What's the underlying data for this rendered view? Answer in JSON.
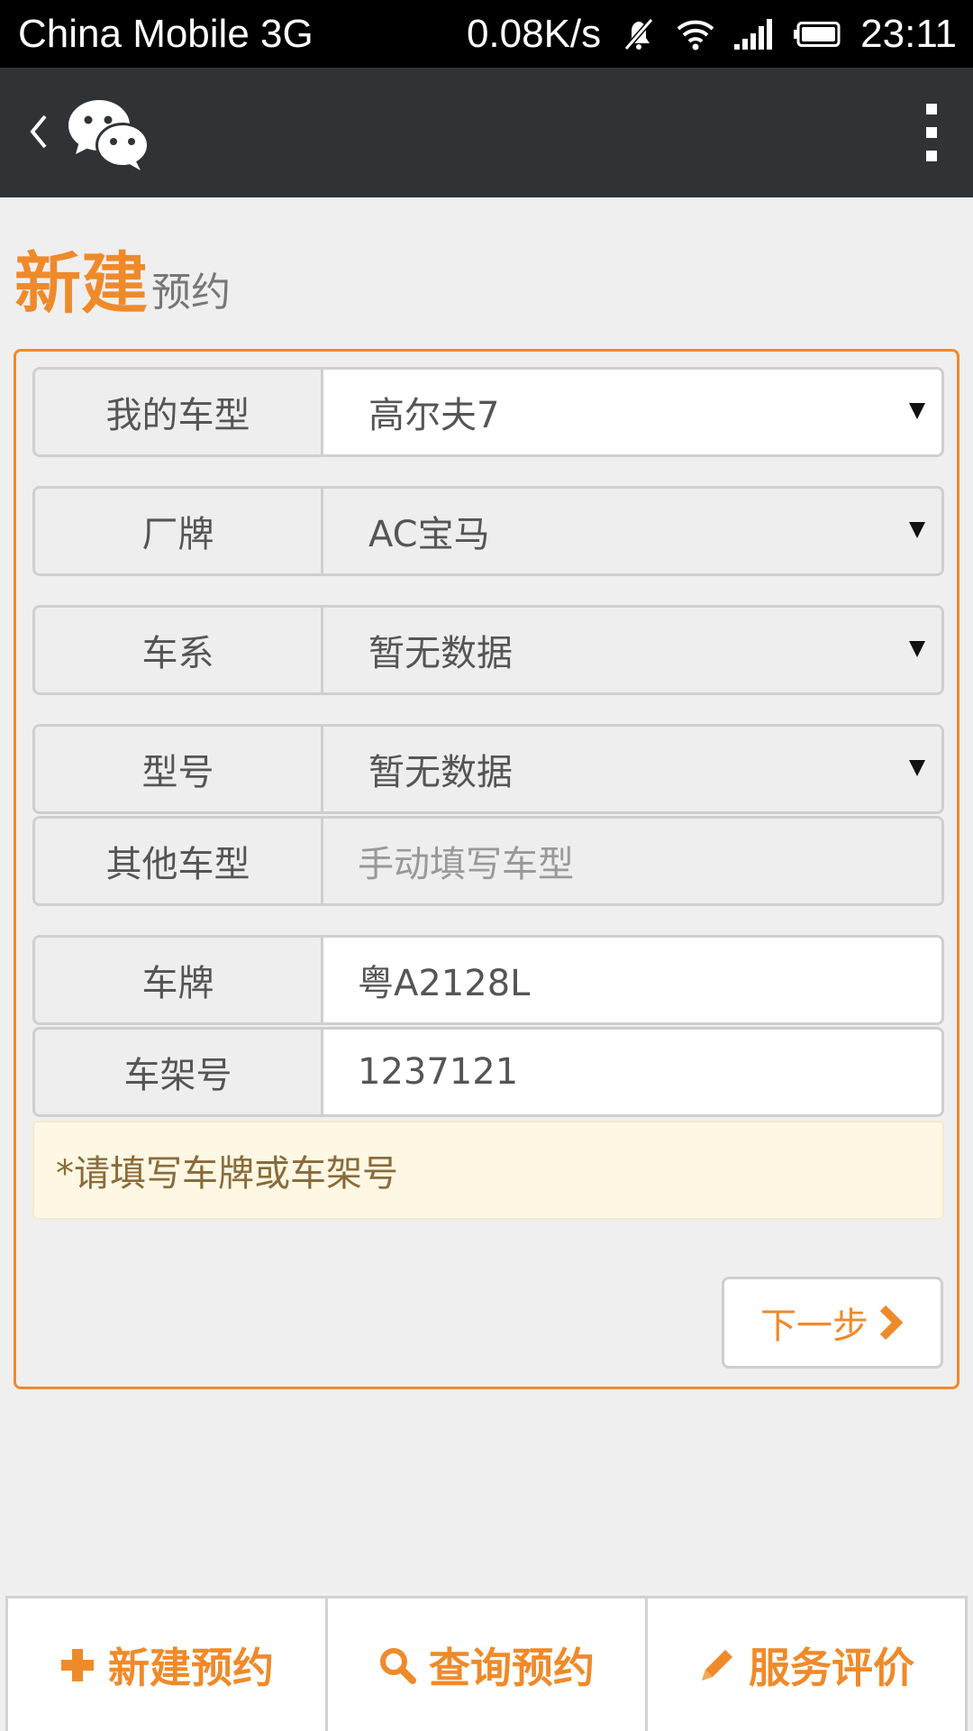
{
  "status_bar": {
    "carrier": "China Mobile 3G",
    "speed": "0.08K/s",
    "time": "23:11",
    "icons": [
      "mute-icon",
      "wifi-icon",
      "signal-icon",
      "battery-icon"
    ]
  },
  "action_bar": {
    "back_icon": "back-chevron-icon",
    "app_icon": "wechat-icon",
    "menu_icon": "more-vertical-icon"
  },
  "page_title": {
    "bold": "新建",
    "light": "预约"
  },
  "form": {
    "car_model": {
      "label": "我的车型",
      "value": "高尔夫7"
    },
    "brand": {
      "label": "厂牌",
      "value": "AC宝马"
    },
    "series": {
      "label": "车系",
      "value": "暂无数据"
    },
    "model_no": {
      "label": "型号",
      "value": "暂无数据"
    },
    "other_model": {
      "label": "其他车型",
      "placeholder": "手动填写车型"
    },
    "plate": {
      "label": "车牌",
      "value": "粤A2128L"
    },
    "vin": {
      "label": "车架号",
      "value": "1237121"
    },
    "notice": "*请填写车牌或车架号",
    "next_label": "下一步"
  },
  "bottom_tabs": [
    {
      "label": "新建预约",
      "icon": "plus-icon"
    },
    {
      "label": "查询预约",
      "icon": "search-icon"
    },
    {
      "label": "服务评价",
      "icon": "pencil-icon"
    }
  ],
  "colors": {
    "accent": "#ef8a2a",
    "status_bar": "#000000",
    "action_bar": "#2f3336",
    "background": "#efefef"
  }
}
